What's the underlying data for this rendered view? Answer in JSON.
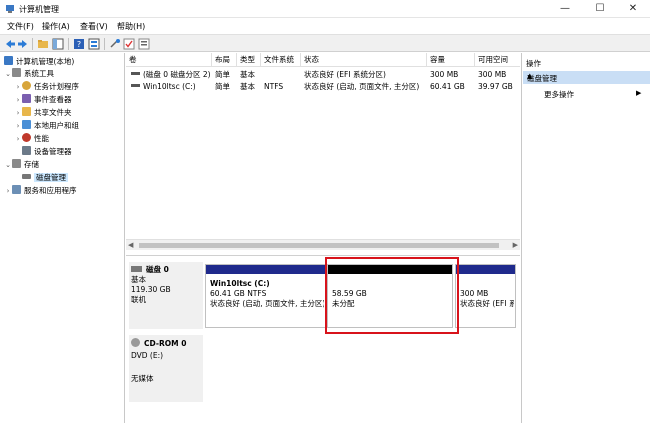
{
  "window": {
    "title": "计算机管理",
    "minimize": "—",
    "maximize": "☐",
    "close": "✕"
  },
  "menu": [
    "文件(F)",
    "操作(A)",
    "查看(V)",
    "帮助(H)"
  ],
  "tree": {
    "root": "计算机管理(本地)",
    "system_tools": "系统工具",
    "task_scheduler": "任务计划程序",
    "event_viewer": "事件查看器",
    "shared_folders": "共享文件夹",
    "local_users": "本地用户和组",
    "performance": "性能",
    "device_manager": "设备管理器",
    "storage": "存储",
    "disk_management": "磁盘管理",
    "services_apps": "服务和应用程序"
  },
  "volume_table": {
    "headers": [
      "卷",
      "布局",
      "类型",
      "文件系统",
      "状态",
      "容量",
      "可用空间"
    ],
    "rows": [
      [
        "(磁盘 0 磁盘分区 2)",
        "简单",
        "基本",
        "",
        "状态良好 (EFI 系统分区)",
        "300 MB",
        "300 MB"
      ],
      [
        "Win10ltsc (C:)",
        "简单",
        "基本",
        "NTFS",
        "状态良好 (启动, 页面文件, 主分区)",
        "60.41 GB",
        "39.97 GB"
      ]
    ]
  },
  "disks": {
    "disk0": {
      "name": "磁盘 0",
      "type": "基本",
      "size": "119.30 GB",
      "status": "联机"
    },
    "partitions": {
      "c": {
        "name": "Win10ltsc  (C:)",
        "size": "60.41 GB NTFS",
        "status": "状态良好 (启动, 页面文件, 主分区)"
      },
      "unalloc": {
        "size": "58.59 GB",
        "status": "未分配"
      },
      "efi": {
        "size": "300 MB",
        "status": "状态良好 (EFI 系统分区)"
      }
    },
    "cdrom": {
      "name": "CD-ROM 0",
      "drive": "DVD (E:)",
      "media": "无媒体"
    }
  },
  "actions": {
    "title": "操作",
    "section": "磁盘管理",
    "more": "更多操作"
  },
  "colors": {
    "primary_partition": "#1f2a8c",
    "unallocated": "#000000",
    "highlight": "#d8131b",
    "selection": "#cce8ff"
  }
}
